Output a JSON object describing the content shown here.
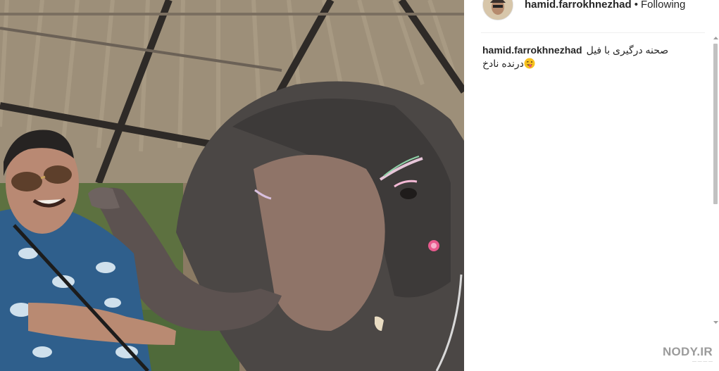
{
  "post": {
    "username": "hamid.farrokhnezhad",
    "separator": "•",
    "follow_state": "Following"
  },
  "caption": {
    "username": "hamid.farrokhnezhad",
    "text": "صحنه درگیری با فیل درنده نادخ",
    "emoji": "tongue-out-wink-emoji"
  },
  "watermark": {
    "text": "NODY.IR"
  },
  "colors": {
    "text": "#262626",
    "divider": "#efefef",
    "scroll_thumb": "#c1c1c1"
  }
}
